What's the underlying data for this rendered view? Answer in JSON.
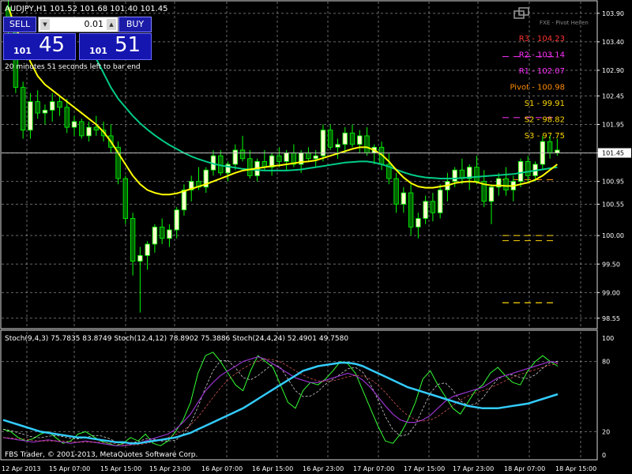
{
  "symbol_header": "AUDJPY,H1  101.52 101.68 101.40 101.45",
  "trade_panel": {
    "sell_label": "SELL",
    "buy_label": "BUY",
    "lot_value": "0.01",
    "bid_prefix": "101",
    "bid_big": "45",
    "ask_prefix": "101",
    "ask_big": "51",
    "timer_text": "20 minutes 51 seconds left to bar end"
  },
  "pivot_indicator_title": "FXE - Pivot Hellen",
  "pivot_labels": [
    {
      "label": "R3 - 104.23",
      "color": "#FF3333"
    },
    {
      "label": "R2 - 103.14",
      "color": "#FF33FF"
    },
    {
      "label": "R1 - 102.07",
      "color": "#FF33FF"
    },
    {
      "label": "Pivot - 100.98",
      "color": "#FF8C00"
    },
    {
      "label": "S1 - 99.91",
      "color": "#FFD700"
    },
    {
      "label": "S2 - 98.82",
      "color": "#FFD700"
    },
    {
      "label": "S3 - 97.75",
      "color": "#FFD700"
    }
  ],
  "current_price_label": "101.45",
  "stoch_header": "Stoch(9,4,3) 75.7835 83.8749   Stoch(12,4,12) 78.8902 75.3886   Stoch(24,4,24) 52.4901 49.7580",
  "copyright": "FBS Trader, © 2001-2013, MetaQuotes Software Corp.",
  "colors": {
    "bull_candle": "#FFFFCC",
    "bear_candle": "#006400",
    "wick": "#00FF00",
    "ma_fast": "#FFFF00",
    "ma_slow": "#00CC88",
    "stoch_fast": "#33FF33",
    "stoch_mid": "#9933CC",
    "stoch_slow": "#33CCFF",
    "grid": "#B0B0B0"
  },
  "chart_data": [
    {
      "type": "candlestick",
      "y_ticks": [
        "103.90",
        "103.40",
        "102.90",
        "102.45",
        "101.95",
        "101.45",
        "100.95",
        "100.55",
        "100.00",
        "99.50",
        "99.00",
        "98.55"
      ],
      "ylim": [
        98.45,
        104.05
      ],
      "x_ticks": [
        "12 Apr 2013",
        "15 Apr 07:00",
        "15 Apr 15:00",
        "15 Apr 23:00",
        "16 Apr 07:00",
        "16 Apr 15:00",
        "16 Apr 23:00",
        "17 Apr 07:00",
        "17 Apr 15:00",
        "17 Apr 23:00",
        "18 Apr 07:00",
        "18 Apr 15:00"
      ],
      "series": [
        {
          "name": "price",
          "ohlc": [
            [
              104.0,
              104.3,
              103.4,
              103.6
            ],
            [
              103.6,
              103.7,
              102.5,
              102.6
            ],
            [
              102.6,
              102.7,
              101.7,
              101.85
            ],
            [
              101.85,
              102.5,
              101.7,
              102.35
            ],
            [
              102.35,
              102.55,
              102.05,
              102.15
            ],
            [
              102.15,
              102.3,
              101.95,
              102.2
            ],
            [
              102.2,
              102.5,
              102.0,
              102.35
            ],
            [
              102.35,
              102.45,
              102.1,
              102.25
            ],
            [
              102.25,
              102.4,
              101.8,
              101.9
            ],
            [
              101.9,
              102.1,
              101.75,
              102.0
            ],
            [
              102.0,
              102.05,
              101.7,
              101.75
            ],
            [
              101.75,
              102.0,
              101.65,
              101.9
            ],
            [
              101.9,
              102.1,
              101.75,
              101.85
            ],
            [
              101.85,
              102.0,
              101.65,
              101.75
            ],
            [
              101.75,
              101.95,
              101.45,
              101.55
            ],
            [
              101.55,
              101.65,
              100.9,
              101.0
            ],
            [
              101.0,
              101.05,
              100.2,
              100.3
            ],
            [
              100.3,
              100.4,
              99.3,
              99.55
            ],
            [
              99.55,
              99.8,
              98.65,
              99.65
            ],
            [
              99.65,
              99.9,
              99.4,
              99.85
            ],
            [
              99.85,
              100.2,
              99.7,
              100.15
            ],
            [
              100.15,
              100.3,
              99.85,
              99.95
            ],
            [
              99.95,
              100.2,
              99.8,
              100.1
            ],
            [
              100.1,
              100.5,
              99.95,
              100.45
            ],
            [
              100.45,
              100.9,
              100.35,
              100.8
            ],
            [
              100.8,
              101.05,
              100.6,
              100.95
            ],
            [
              100.95,
              101.2,
              100.8,
              100.85
            ],
            [
              100.85,
              101.2,
              100.75,
              101.15
            ],
            [
              101.15,
              101.5,
              101.05,
              101.4
            ],
            [
              101.4,
              101.5,
              101.05,
              101.1
            ],
            [
              101.1,
              101.3,
              100.95,
              101.25
            ],
            [
              101.25,
              101.6,
              101.15,
              101.5
            ],
            [
              101.5,
              101.75,
              101.3,
              101.35
            ],
            [
              101.35,
              101.5,
              101.0,
              101.05
            ],
            [
              101.05,
              101.35,
              100.95,
              101.3
            ],
            [
              101.3,
              101.5,
              101.15,
              101.2
            ],
            [
              101.2,
              101.45,
              101.05,
              101.4
            ],
            [
              101.4,
              101.55,
              101.2,
              101.3
            ],
            [
              101.3,
              101.5,
              101.15,
              101.45
            ],
            [
              101.45,
              101.6,
              101.2,
              101.25
            ],
            [
              101.25,
              101.5,
              101.1,
              101.45
            ],
            [
              101.45,
              101.55,
              101.3,
              101.35
            ],
            [
              101.35,
              101.5,
              101.2,
              101.4
            ],
            [
              101.4,
              101.95,
              101.3,
              101.85
            ],
            [
              101.85,
              101.95,
              101.5,
              101.55
            ],
            [
              101.55,
              101.7,
              101.35,
              101.6
            ],
            [
              101.6,
              101.9,
              101.45,
              101.8
            ],
            [
              101.8,
              101.95,
              101.55,
              101.6
            ],
            [
              101.6,
              101.85,
              101.45,
              101.75
            ],
            [
              101.75,
              101.9,
              101.4,
              101.45
            ],
            [
              101.45,
              101.6,
              101.25,
              101.55
            ],
            [
              101.55,
              101.65,
              101.15,
              101.25
            ],
            [
              101.25,
              101.45,
              100.9,
              101.0
            ],
            [
              101.0,
              101.1,
              100.4,
              100.55
            ],
            [
              100.55,
              100.85,
              100.4,
              100.75
            ],
            [
              100.75,
              100.9,
              100.0,
              100.15
            ],
            [
              100.15,
              100.4,
              99.95,
              100.3
            ],
            [
              100.3,
              100.7,
              100.2,
              100.6
            ],
            [
              100.6,
              100.75,
              100.25,
              100.4
            ],
            [
              100.4,
              100.9,
              100.3,
              100.8
            ],
            [
              100.8,
              101.1,
              100.6,
              100.95
            ],
            [
              100.95,
              101.2,
              100.85,
              101.15
            ],
            [
              101.15,
              101.35,
              100.9,
              101.0
            ],
            [
              101.0,
              101.25,
              100.8,
              101.2
            ],
            [
              101.2,
              101.4,
              100.9,
              100.95
            ],
            [
              100.95,
              101.15,
              100.5,
              100.6
            ],
            [
              100.6,
              100.9,
              100.2,
              100.85
            ],
            [
              100.85,
              101.1,
              100.7,
              101.0
            ],
            [
              101.0,
              101.2,
              100.7,
              100.8
            ],
            [
              100.8,
              101.05,
              100.6,
              100.95
            ],
            [
              100.95,
              101.35,
              100.85,
              101.3
            ],
            [
              101.3,
              101.4,
              100.95,
              101.05
            ],
            [
              101.05,
              101.3,
              100.95,
              101.25
            ],
            [
              101.25,
              101.75,
              101.15,
              101.65
            ],
            [
              101.65,
              101.75,
              101.35,
              101.45
            ],
            [
              101.45,
              101.7,
              101.4,
              101.5
            ]
          ]
        },
        {
          "name": "ma_fast",
          "values": [
            104.0,
            103.65,
            103.35,
            103.05,
            102.8,
            102.65,
            102.55,
            102.45,
            102.35,
            102.25,
            102.15,
            102.05,
            101.95,
            101.82,
            101.65,
            101.45,
            101.25,
            101.05,
            100.9,
            100.8,
            100.75,
            100.72,
            100.72,
            100.74,
            100.78,
            100.82,
            100.86,
            100.9,
            100.95,
            101.0,
            101.05,
            101.1,
            101.14,
            101.16,
            101.18,
            101.2,
            101.22,
            101.23,
            101.25,
            101.27,
            101.29,
            101.3,
            101.32,
            101.36,
            101.4,
            101.44,
            101.48,
            101.52,
            101.55,
            101.55,
            101.5,
            101.42,
            101.3,
            101.15,
            101.02,
            100.92,
            100.86,
            100.84,
            100.84,
            100.86,
            100.88,
            100.92,
            100.94,
            100.95,
            100.94,
            100.9,
            100.88,
            100.88,
            100.87,
            100.87,
            100.9,
            100.93,
            100.98,
            101.05,
            101.15,
            101.25
          ]
        },
        {
          "name": "ma_slow",
          "values": [
            null,
            null,
            null,
            null,
            null,
            null,
            null,
            null,
            null,
            null,
            null,
            103.4,
            103.1,
            102.85,
            102.6,
            102.4,
            102.25,
            102.1,
            101.97,
            101.86,
            101.76,
            101.67,
            101.59,
            101.52,
            101.45,
            101.39,
            101.34,
            101.3,
            101.26,
            101.23,
            101.21,
            101.19,
            101.17,
            101.16,
            101.15,
            101.14,
            101.14,
            101.14,
            101.14,
            101.15,
            101.16,
            101.18,
            101.2,
            101.22,
            101.24,
            101.26,
            101.28,
            101.29,
            101.3,
            101.3,
            101.28,
            101.25,
            101.21,
            101.16,
            101.11,
            101.07,
            101.04,
            101.02,
            101.01,
            101.0,
            101.0,
            101.0,
            101.01,
            101.02,
            101.03,
            101.04,
            101.05,
            101.06,
            101.07,
            101.08,
            101.1,
            101.12,
            101.14,
            101.16,
            101.18,
            101.2
          ]
        }
      ]
    },
    {
      "type": "line",
      "y_ticks": [
        "100",
        "80",
        "20",
        "0"
      ],
      "ylim": [
        0,
        100
      ],
      "series": [
        {
          "name": "Stoch(9,4,3)",
          "values": [
            22,
            20,
            15,
            12,
            14,
            18,
            20,
            15,
            10,
            12,
            18,
            20,
            16,
            12,
            10,
            8,
            10,
            15,
            12,
            18,
            10,
            8,
            12,
            20,
            30,
            45,
            70,
            85,
            88,
            80,
            70,
            60,
            55,
            72,
            85,
            80,
            75,
            60,
            45,
            40,
            55,
            62,
            60,
            65,
            72,
            80,
            78,
            70,
            55,
            40,
            25,
            12,
            10,
            18,
            30,
            45,
            65,
            72,
            60,
            50,
            40,
            35,
            45,
            55,
            60,
            70,
            75,
            68,
            62,
            60,
            72,
            80,
            85,
            80,
            76
          ]
        },
        {
          "name": "Stoch(12,4,12)",
          "values": [
            15,
            14,
            13,
            12,
            11,
            12,
            13,
            12,
            11,
            10,
            11,
            12,
            11,
            10,
            9,
            8,
            8,
            9,
            10,
            12,
            14,
            16,
            18,
            22,
            28,
            35,
            45,
            55,
            62,
            68,
            72,
            76,
            80,
            82,
            84,
            82,
            78,
            74,
            70,
            66,
            64,
            62,
            62,
            64,
            66,
            68,
            70,
            68,
            64,
            58,
            50,
            42,
            35,
            30,
            28,
            28,
            30,
            34,
            40,
            46,
            50,
            52,
            54,
            56,
            58,
            62,
            66,
            68,
            70,
            72,
            74,
            76,
            78,
            80,
            79
          ]
        },
        {
          "name": "Stoch(24,4,24)",
          "values": [
            30,
            28,
            26,
            24,
            22,
            20,
            19,
            18,
            17,
            16,
            15,
            15,
            14,
            13,
            12,
            11,
            11,
            10,
            10,
            11,
            12,
            13,
            14,
            15,
            17,
            19,
            22,
            25,
            28,
            31,
            34,
            37,
            40,
            44,
            48,
            52,
            56,
            60,
            64,
            68,
            72,
            74,
            76,
            77,
            78,
            79,
            79,
            78,
            76,
            73,
            70,
            67,
            64,
            61,
            58,
            56,
            54,
            52,
            50,
            48,
            46,
            44,
            42,
            41,
            40,
            40,
            40,
            41,
            42,
            43,
            44,
            46,
            48,
            50,
            52
          ]
        }
      ]
    }
  ]
}
